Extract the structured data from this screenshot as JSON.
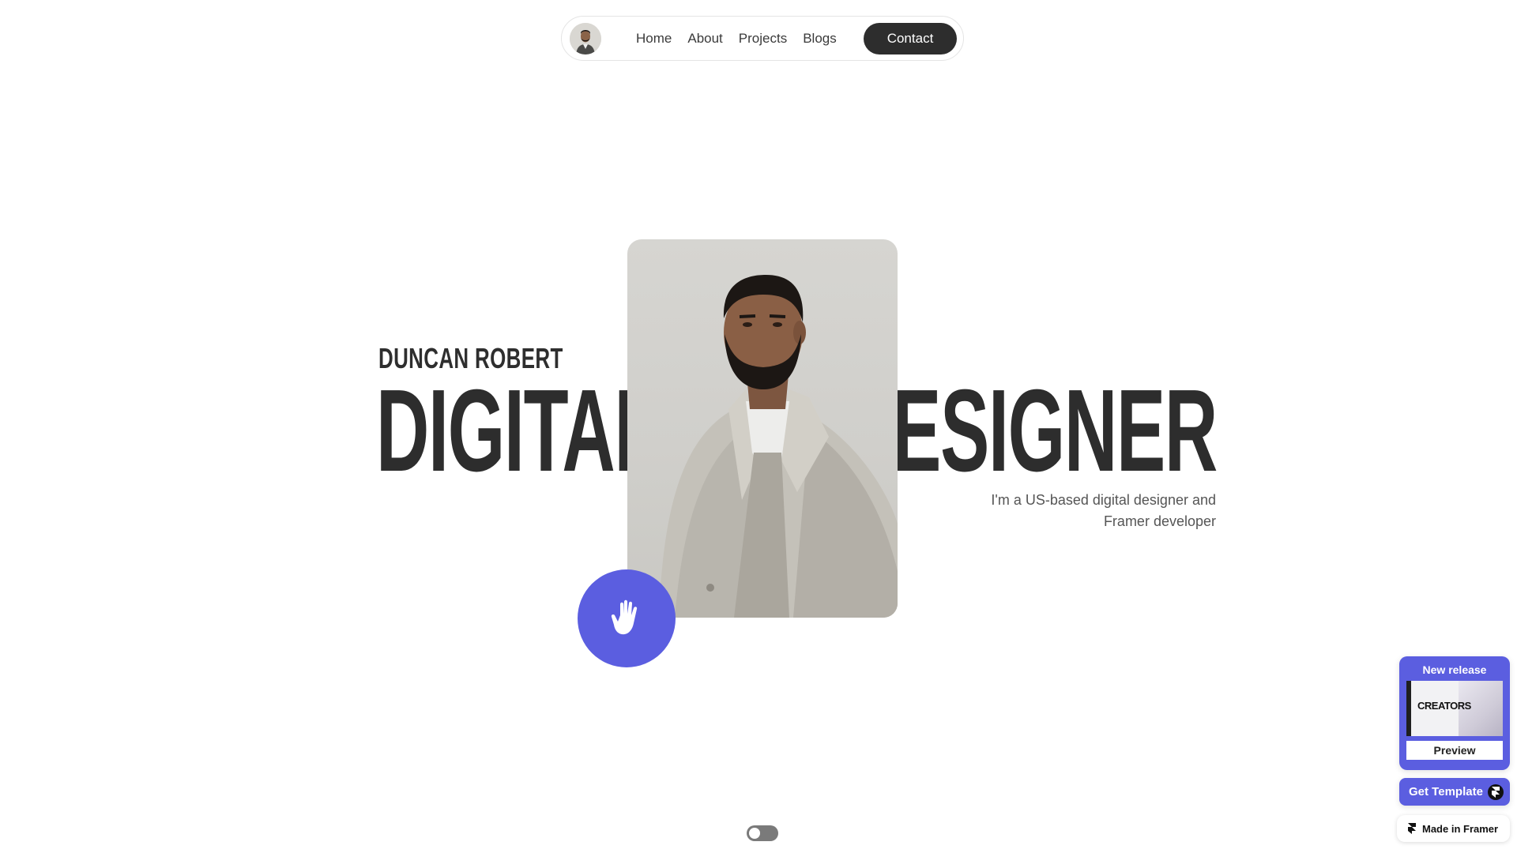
{
  "nav": {
    "links": [
      "Home",
      "About",
      "Projects",
      "Blogs"
    ],
    "contact_label": "Contact"
  },
  "hero": {
    "name": "DUNCAN ROBERT",
    "word_left": "DIGITAL",
    "word_right": "DESIGNER",
    "tagline_line1": "I'm a US-based digital designer and",
    "tagline_line2": "Framer developer"
  },
  "framer": {
    "release_title": "New release",
    "thumb_text": "CREATORS",
    "preview_label": "Preview",
    "get_template_label": "Get Template",
    "made_in_label": "Made in Framer"
  },
  "colors": {
    "accent": "#5b5ee0",
    "dark": "#2d2d2d"
  }
}
